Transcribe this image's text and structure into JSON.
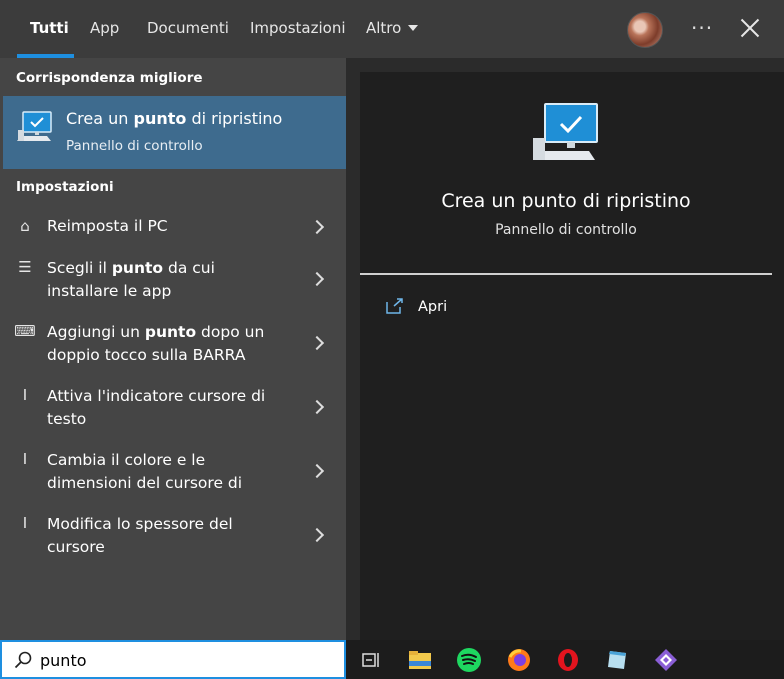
{
  "tabs": [
    {
      "label": "Tutti",
      "active": true
    },
    {
      "label": "App"
    },
    {
      "label": "Documenti"
    },
    {
      "label": "Impostazioni"
    },
    {
      "label": "Altro"
    }
  ],
  "header": {
    "more_label": "···"
  },
  "best_match": {
    "section_title": "Corrispondenza migliore",
    "title_pre": "Crea un ",
    "title_bold": "punto",
    "title_post": " di ripristino",
    "subtitle": "Pannello di controllo",
    "icon": "computer-check-icon"
  },
  "settings": {
    "section_title": "Impostazioni",
    "items": [
      {
        "icon": "reset-pc-icon",
        "glyph": "⌂",
        "pre": "Reimposta il PC",
        "bold": "",
        "post": ""
      },
      {
        "icon": "app-list-icon",
        "glyph": "☰",
        "pre": "Scegli il ",
        "bold": "punto",
        "post": " da cui installare le app"
      },
      {
        "icon": "keyboard-icon",
        "glyph": "⌨",
        "pre": "Aggiungi un ",
        "bold": "punto",
        "post": " dopo un doppio tocco sulla BARRA"
      },
      {
        "icon": "text-cursor-icon",
        "glyph": "I",
        "pre": "Attiva l'indicatore cursore di testo",
        "bold": "",
        "post": ""
      },
      {
        "icon": "text-cursor-icon",
        "glyph": "I",
        "pre": "Cambia il colore e le dimensioni del cursore di",
        "bold": "",
        "post": ""
      },
      {
        "icon": "text-cursor-icon",
        "glyph": "I",
        "pre": "Modifica lo spessore del cursore",
        "bold": "",
        "post": ""
      }
    ]
  },
  "preview": {
    "title": "Crea un punto di ripristino",
    "subtitle": "Pannello di controllo",
    "open_label": "Apri"
  },
  "search": {
    "value": "punto"
  },
  "taskbar": {
    "items": [
      "task-view-icon",
      "file-explorer-icon",
      "spotify-icon",
      "firefox-icon",
      "opera-icon",
      "notepad-icon",
      "visual-studio-icon"
    ]
  },
  "colors": {
    "accent": "#1e8fe0",
    "selected": "#3e6b8e"
  }
}
